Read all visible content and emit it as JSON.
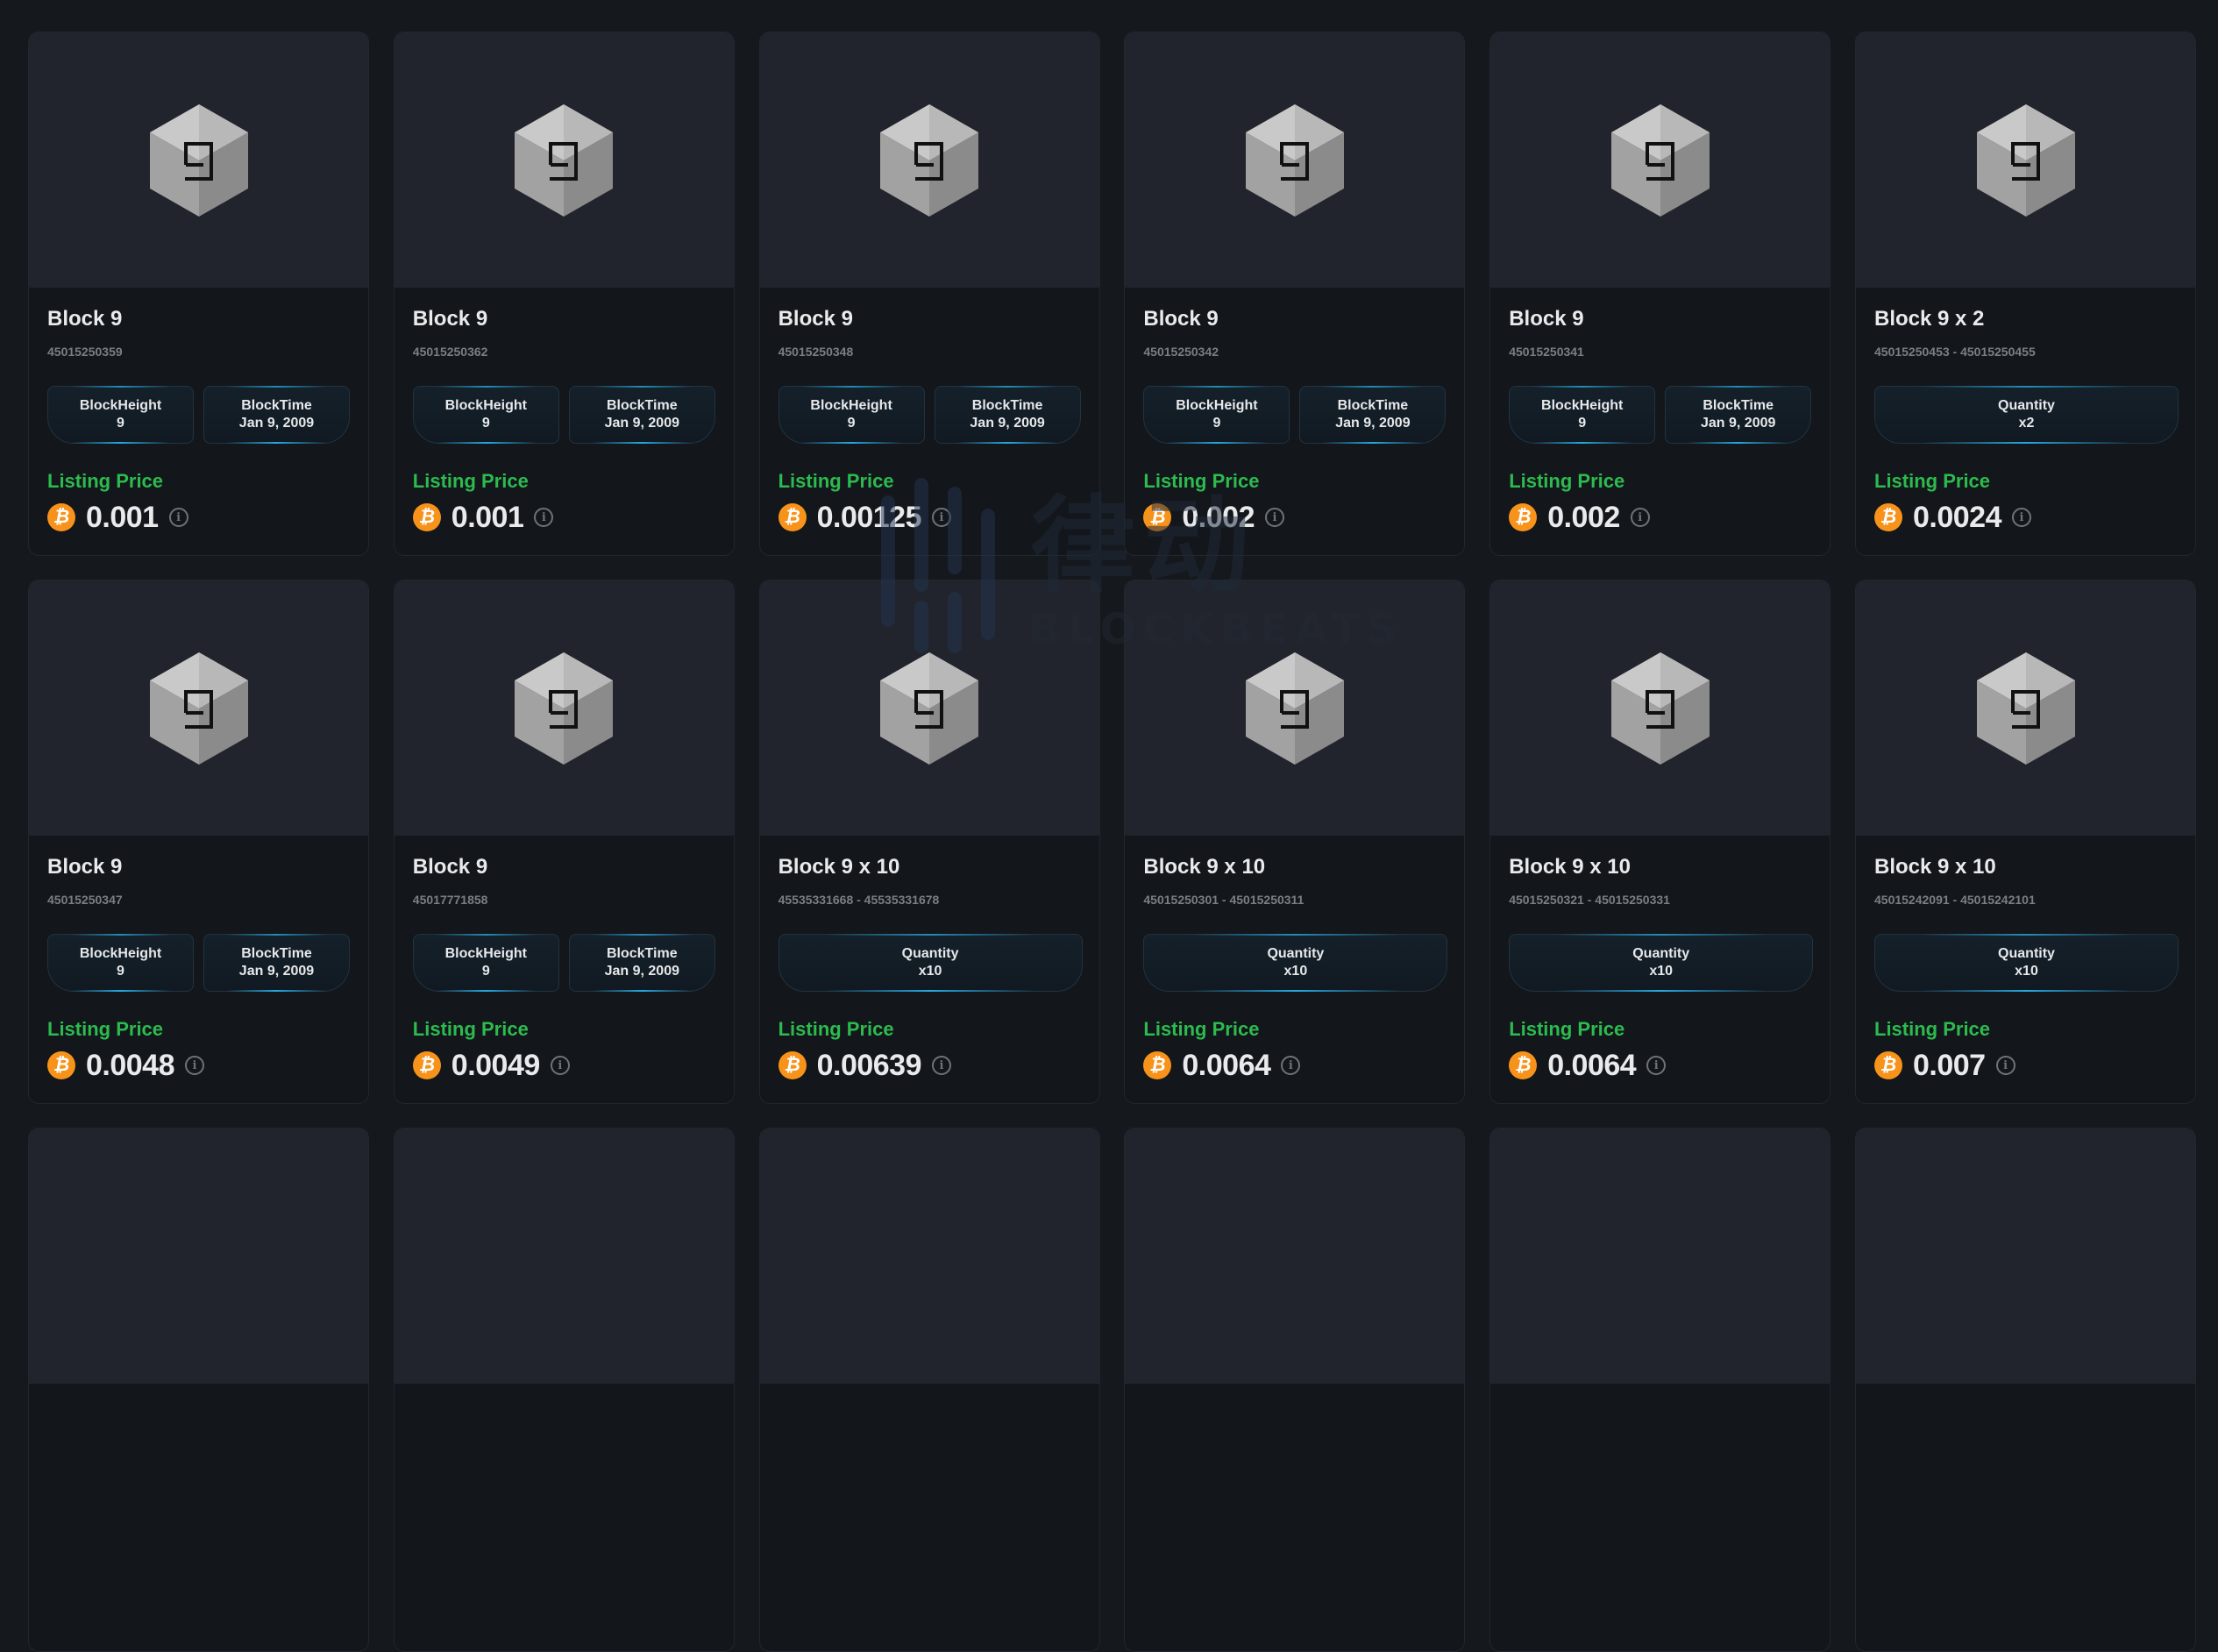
{
  "labels": {
    "listing_price": "Listing Price",
    "block_height": "BlockHeight",
    "block_time": "BlockTime",
    "quantity": "Quantity",
    "btc_symbol": "₿",
    "info_symbol": "i"
  },
  "colors": {
    "page_bg": "#15181c",
    "card_bg": "#13161a",
    "image_bg": "#21242c",
    "listing_green": "#2cbb4f",
    "btc_orange": "#f7931a",
    "badge_glow": "#27a9e0"
  },
  "watermark": {
    "chinese": "律动",
    "text": "BLOCKBEATS"
  },
  "cards": [
    {
      "title": "Block 9",
      "id": "45015250359",
      "type": "single",
      "block_height": "9",
      "block_time": "Jan 9, 2009",
      "price": "0.001",
      "cube_digit": "9"
    },
    {
      "title": "Block 9",
      "id": "45015250362",
      "type": "single",
      "block_height": "9",
      "block_time": "Jan 9, 2009",
      "price": "0.001",
      "cube_digit": "9"
    },
    {
      "title": "Block 9",
      "id": "45015250348",
      "type": "single",
      "block_height": "9",
      "block_time": "Jan 9, 2009",
      "price": "0.00125",
      "cube_digit": "9"
    },
    {
      "title": "Block 9",
      "id": "45015250342",
      "type": "single",
      "block_height": "9",
      "block_time": "Jan 9, 2009",
      "price": "0.002",
      "cube_digit": "9"
    },
    {
      "title": "Block 9",
      "id": "45015250341",
      "type": "single",
      "block_height": "9",
      "block_time": "Jan 9, 2009",
      "price": "0.002",
      "cube_digit": "9"
    },
    {
      "title": "Block 9 x 2",
      "id": "45015250453 - 45015250455",
      "type": "bundle",
      "quantity": "x2",
      "price": "0.0024",
      "cube_digit": "9"
    },
    {
      "title": "Block 9",
      "id": "45015250347",
      "type": "single",
      "block_height": "9",
      "block_time": "Jan 9, 2009",
      "price": "0.0048",
      "cube_digit": "9"
    },
    {
      "title": "Block 9",
      "id": "45017771858",
      "type": "single",
      "block_height": "9",
      "block_time": "Jan 9, 2009",
      "price": "0.0049",
      "cube_digit": "9"
    },
    {
      "title": "Block 9 x 10",
      "id": "45535331668 - 45535331678",
      "type": "bundle",
      "quantity": "x10",
      "price": "0.00639",
      "cube_digit": "9"
    },
    {
      "title": "Block 9 x 10",
      "id": "45015250301 - 45015250311",
      "type": "bundle",
      "quantity": "x10",
      "price": "0.0064",
      "cube_digit": "9"
    },
    {
      "title": "Block 9 x 10",
      "id": "45015250321 - 45015250331",
      "type": "bundle",
      "quantity": "x10",
      "price": "0.0064",
      "cube_digit": "9"
    },
    {
      "title": "Block 9 x 10",
      "id": "45015242091 - 45015242101",
      "type": "bundle",
      "quantity": "x10",
      "price": "0.007",
      "cube_digit": "9"
    }
  ],
  "partial_row_cards": 6
}
